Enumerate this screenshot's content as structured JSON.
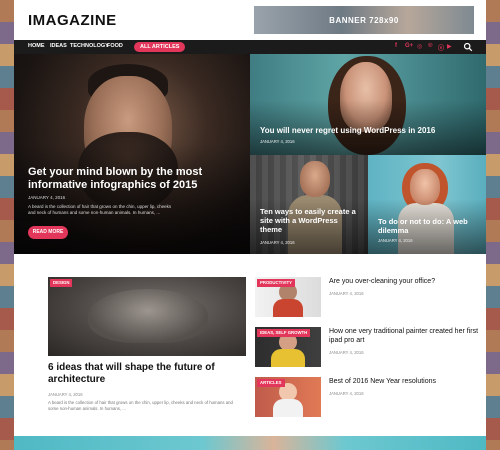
{
  "header": {
    "logo": "IMAGAZINE",
    "banner_text": "BANNER 728x90"
  },
  "nav": {
    "items": [
      "HOME",
      "IDEAS",
      "TECHNOLOGY",
      "FOOD"
    ],
    "active": "ALL ARTICLES",
    "social_icons": [
      "facebook-icon",
      "google-plus-icon",
      "instagram-icon",
      "pinterest-icon",
      "vk-icon",
      "youtube-icon"
    ],
    "social_glyphs": [
      "f",
      "G+",
      "◎",
      "℗",
      "ⓥ",
      "▶"
    ]
  },
  "hero": {
    "main": {
      "title": "Get your mind blown by the most informative infographics of 2015",
      "date": "JANUARY 4, 2016",
      "excerpt": "A beard is the collection of hair that grows on the chin, upper lip, cheeks and neck of humans and some non-human animals. In humans, ...",
      "button": "READ MORE"
    },
    "top_right": {
      "title": "You will never regret using WordPress in 2016",
      "date": "JANUARY 4, 2016"
    },
    "bottom_left": {
      "title": "Ten ways to easily create a site with a WordPress theme",
      "date": "JANUARY 4, 2016"
    },
    "bottom_right": {
      "title": "To do or not to do: A web dilemma",
      "date": "JANUARY 4, 2016"
    }
  },
  "featured": {
    "tag": "DESIGN",
    "title": "6 ideas that will shape the future of architecture",
    "date": "JANUARY 4, 2016",
    "excerpt": "A beard is the collection of hair that grows on the chin, upper lip, cheeks and neck of humans and some non-human animals. In humans, ..."
  },
  "side_posts": [
    {
      "tag": "PRODUCTIVITY",
      "title": "Are you over-cleaning your office?",
      "date": "JANUARY 4, 2016"
    },
    {
      "tag": "IDEAS, SELF GROWTH",
      "title": "How one very traditional painter created her first ipad pro art",
      "date": "JANUARY 4, 2016"
    },
    {
      "tag": "ARTICLES",
      "title": "Best of 2016 New Year resolutions",
      "date": "JANUARY 4, 2016"
    }
  ],
  "colors": {
    "accent": "#e2365a",
    "nav_bg": "#1b1b1b"
  }
}
